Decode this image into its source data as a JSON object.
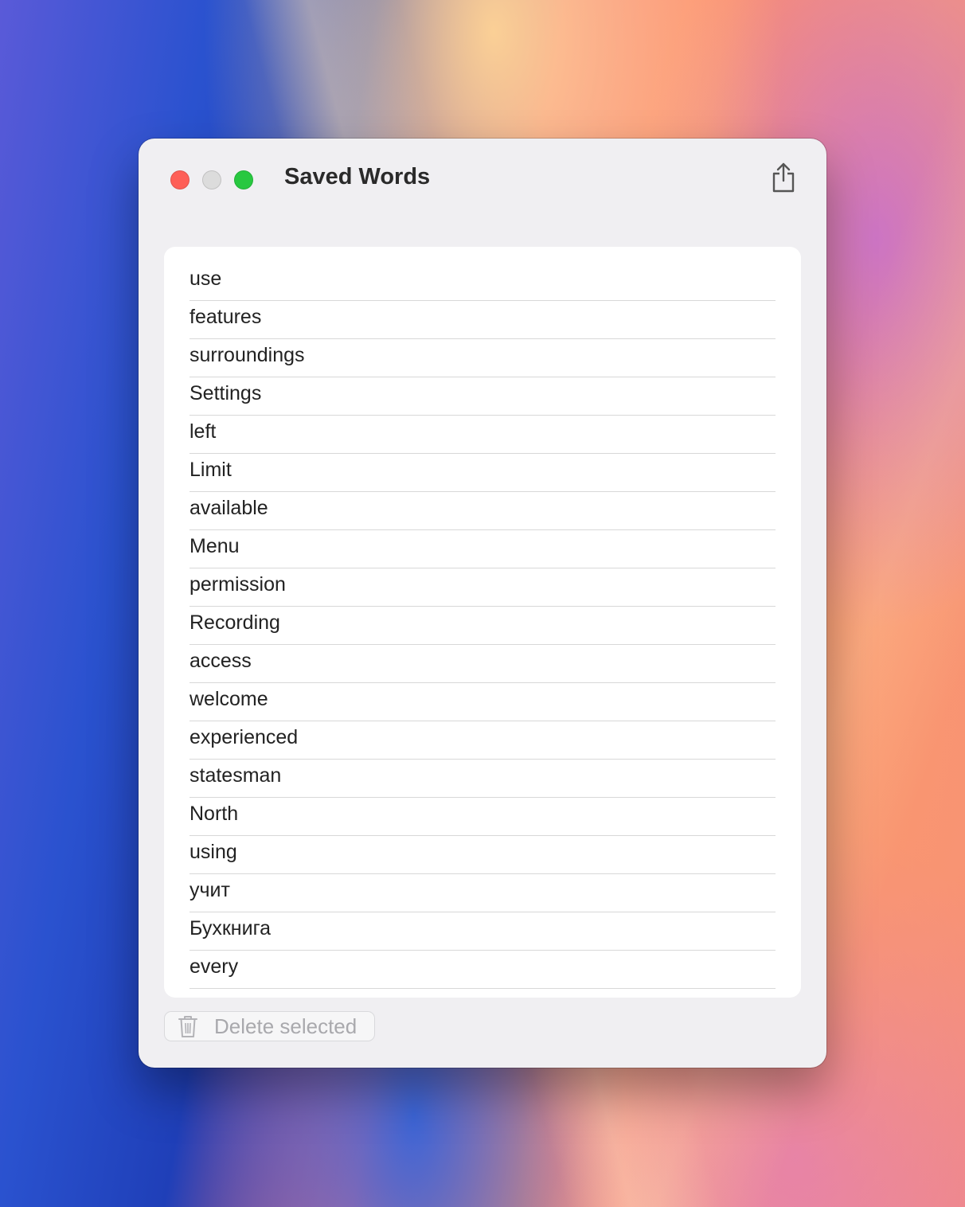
{
  "window": {
    "title": "Saved Words"
  },
  "words": [
    "use",
    "features",
    "surroundings",
    "Settings",
    "left",
    "Limit",
    "available",
    "Menu",
    "permission",
    "Recording",
    "access",
    "welcome",
    "experienced",
    "statesman",
    "North",
    "using",
    "учит",
    "Бухкнига",
    "every"
  ],
  "footer": {
    "delete_label": "Delete selected"
  },
  "icons": {
    "share": "share-icon",
    "trash": "trash-icon"
  },
  "colors": {
    "close": "#fe5f57",
    "minimize": "#dcdcdc",
    "maximize": "#28c840",
    "disabled_text": "#a9a9ad"
  }
}
